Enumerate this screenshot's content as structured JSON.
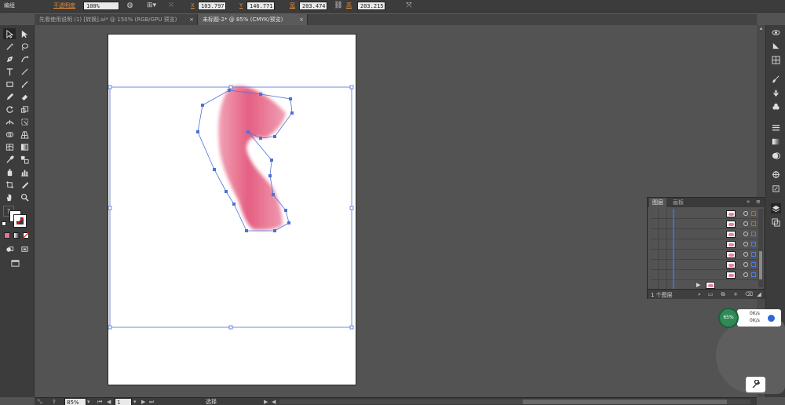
{
  "control_bar": {
    "mode_label": "编组",
    "opacity_label": "不透明度",
    "opacity_value": "100%",
    "x_label": "X",
    "x_value": "103.797",
    "y_label": "Y",
    "y_value": "146.771",
    "w_label": "宽",
    "w_value": "203.474",
    "h_label": "高",
    "h_value": "203.215"
  },
  "tabs": [
    {
      "label": "先看使用说明 (1) [转换].ai* @ 150% (RGB/GPU 预览)",
      "state": "inactive"
    },
    {
      "label": "未标题-2* @ 85% (CMYK/预览)",
      "state": "active"
    }
  ],
  "tools": [
    "selection-tool-icon",
    "direct-selection-tool-icon",
    "magic-wand-icon",
    "lasso-icon",
    "pen-tool-icon",
    "curvature-tool-icon",
    "type-tool-icon",
    "line-segment-icon",
    "rectangle-tool-icon",
    "paintbrush-icon",
    "pencil-icon",
    "eraser-icon",
    "rotate-tool-icon",
    "scale-tool-icon",
    "width-tool-icon",
    "free-transform-icon",
    "shape-builder-icon",
    "perspective-grid-icon",
    "mesh-tool-icon",
    "gradient-tool-icon",
    "eyedropper-icon",
    "blend-tool-icon",
    "symbol-sprayer-icon",
    "column-graph-icon",
    "artboard-tool-icon",
    "slice-tool-icon",
    "hand-tool-icon",
    "zoom-tool-icon"
  ],
  "toolbar_help": "?",
  "colors": {
    "fill": "#ffffff",
    "stroke": "#e02020",
    "shape_fill": "#e8728f",
    "selection_blue": "#4a72d6",
    "layer_bar_blue": "#3b6de0"
  },
  "dock_icons": [
    "appearance-icon",
    "graphic-styles-icon",
    "color-guide-icon",
    "brushes-icon",
    "symbols-icon",
    "swatches-icon",
    "stroke-icon",
    "gradient-icon",
    "transparency-icon",
    "align-icon",
    "transform-icon",
    "layers-icon",
    "artboards-icon"
  ],
  "layers_panel": {
    "tabs": [
      "图层",
      "画板"
    ],
    "footer_label": "1 个图层",
    "row_count": 7
  },
  "speed_widget": {
    "circle_text": "65%",
    "up": "0K/s",
    "down": "0K/s"
  },
  "status_bar": {
    "zoom_value": "85%",
    "artboard_value": "1",
    "tool_label": "选择"
  }
}
